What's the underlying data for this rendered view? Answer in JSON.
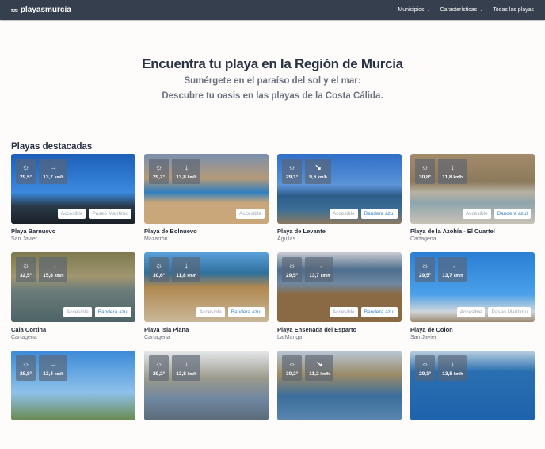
{
  "nav": {
    "logo": "playasmurcia",
    "logo_icon": "waves-icon",
    "items": [
      {
        "label": "Municipios",
        "dropdown": true
      },
      {
        "label": "Características",
        "dropdown": true
      },
      {
        "label": "Todas las playas",
        "dropdown": false
      }
    ]
  },
  "hero": {
    "title": "Encuentra tu playa en la Región de Murcia",
    "line1": "Sumérgete en el paraíso del sol y el mar:",
    "line2": "Descubre tu oasis en las playas de la Costa Cálida."
  },
  "section_title": "Playas destacadas",
  "beaches": [
    {
      "name": "Playa Barnuevo",
      "town": "San Javier",
      "temp": "29,5°",
      "wind": "13,7",
      "unit": "km/h",
      "arrow": "→",
      "tags": [
        [
          "Accesible",
          ""
        ],
        [
          "Paseo Marítimo",
          ""
        ]
      ],
      "bg": "linear-gradient(#1d5fb8,#3b8ae0 55%,#2a3a4a 75%,#1a1f25)"
    },
    {
      "name": "Playa de Bolnuevo",
      "town": "Mazarrón",
      "temp": "29,2°",
      "wind": "13,8",
      "unit": "km/h",
      "arrow": "↓",
      "tags": [
        [
          "Accesible",
          ""
        ]
      ],
      "bg": "linear-gradient(#7a8fae,#b59a78 35%,#2f7fc0 55%,#c9a77a 70%,#c9a77a)"
    },
    {
      "name": "Playa de Levante",
      "town": "Águilas",
      "temp": "29,1°",
      "wind": "9,6",
      "unit": "km/h",
      "arrow": "↘",
      "tags": [
        [
          "Accesible",
          ""
        ],
        [
          "Bandera azul",
          "blue"
        ]
      ],
      "bg": "linear-gradient(#2f6fc7,#5b94d6 45%,#2d5c8a 60%,#3c6e96 80%,#8a7a60)"
    },
    {
      "name": "Playa de la Azohía - El Cuartel",
      "town": "Cartagena",
      "temp": "30,8°",
      "wind": "11,8",
      "unit": "km/h",
      "arrow": "↓",
      "tags": [
        [
          "Accesible",
          ""
        ],
        [
          "Bandera azul",
          "blue"
        ]
      ],
      "bg": "linear-gradient(#a38b6a,#8c7a5c 40%,#b7b2a2 55%,#8fa6ac 70%,#c8c2b6)"
    },
    {
      "name": "Cala Cortina",
      "town": "Cartagena",
      "temp": "32,5°",
      "wind": "15,8",
      "unit": "km/h",
      "arrow": "→",
      "tags": [
        [
          "Accesible",
          ""
        ],
        [
          "Bandera azul",
          "blue"
        ]
      ],
      "bg": "linear-gradient(#7d7a4e,#a09670 35%,#6b7c7a 55%,#4e6466)"
    },
    {
      "name": "Playa Isla Plana",
      "town": "Cartagena",
      "temp": "30,6°",
      "wind": "11,8",
      "unit": "km/h",
      "arrow": "↓",
      "tags": [
        [
          "Accesible",
          ""
        ],
        [
          "Bandera azul",
          "blue"
        ]
      ],
      "bg": "linear-gradient(#5aa0da,#2f6f9c 30%,#b08850 50%,#c9b89a)"
    },
    {
      "name": "Playa Ensenada del Esparto",
      "town": "La Manga",
      "temp": "29,5°",
      "wind": "13,7",
      "unit": "km/h",
      "arrow": "→",
      "tags": [
        [
          "Accesible",
          ""
        ],
        [
          "Bandera azul",
          "blue"
        ]
      ],
      "bg": "linear-gradient(#c9ccd0,#4d6e8f 25%,#6e88a0 45%,#8a6a45 60%,#8a6a45)"
    },
    {
      "name": "Playa de Colón",
      "town": "San Javier",
      "temp": "29,5°",
      "wind": "13,7",
      "unit": "km/h",
      "arrow": "→",
      "tags": [
        [
          "Accesible",
          ""
        ],
        [
          "Paseo Marítimo",
          ""
        ]
      ],
      "bg": "linear-gradient(#2a7fd6,#4aa0e8 60%,#cfd6da 85%,#a08a70)"
    },
    {
      "name": "",
      "town": "",
      "temp": "28,8°",
      "wind": "13,4",
      "unit": "km/h",
      "arrow": "→",
      "tags": [],
      "bg": "linear-gradient(#3b8ad8,#8ec1ea 60%,#6a8a50)"
    },
    {
      "name": "",
      "town": "",
      "temp": "29,2°",
      "wind": "13,8",
      "unit": "km/h",
      "arrow": "↓",
      "tags": [],
      "bg": "linear-gradient(#e6e8ea,#9a9a8c 40%,#6f86a0 70%,#5a6b78)"
    },
    {
      "name": "",
      "town": "",
      "temp": "30,2°",
      "wind": "11,2",
      "unit": "km/h",
      "arrow": "↘",
      "tags": [],
      "bg": "linear-gradient(#b8c8d8,#9a8a66 35%,#3b6e9c 65%,#5a86b0)"
    },
    {
      "name": "",
      "town": "",
      "temp": "29,1°",
      "wind": "13,8",
      "unit": "km/h",
      "arrow": "↓",
      "tags": [],
      "bg": "linear-gradient(#bcd0e0,#2a6fb0 30%,#1d63ad)"
    }
  ]
}
